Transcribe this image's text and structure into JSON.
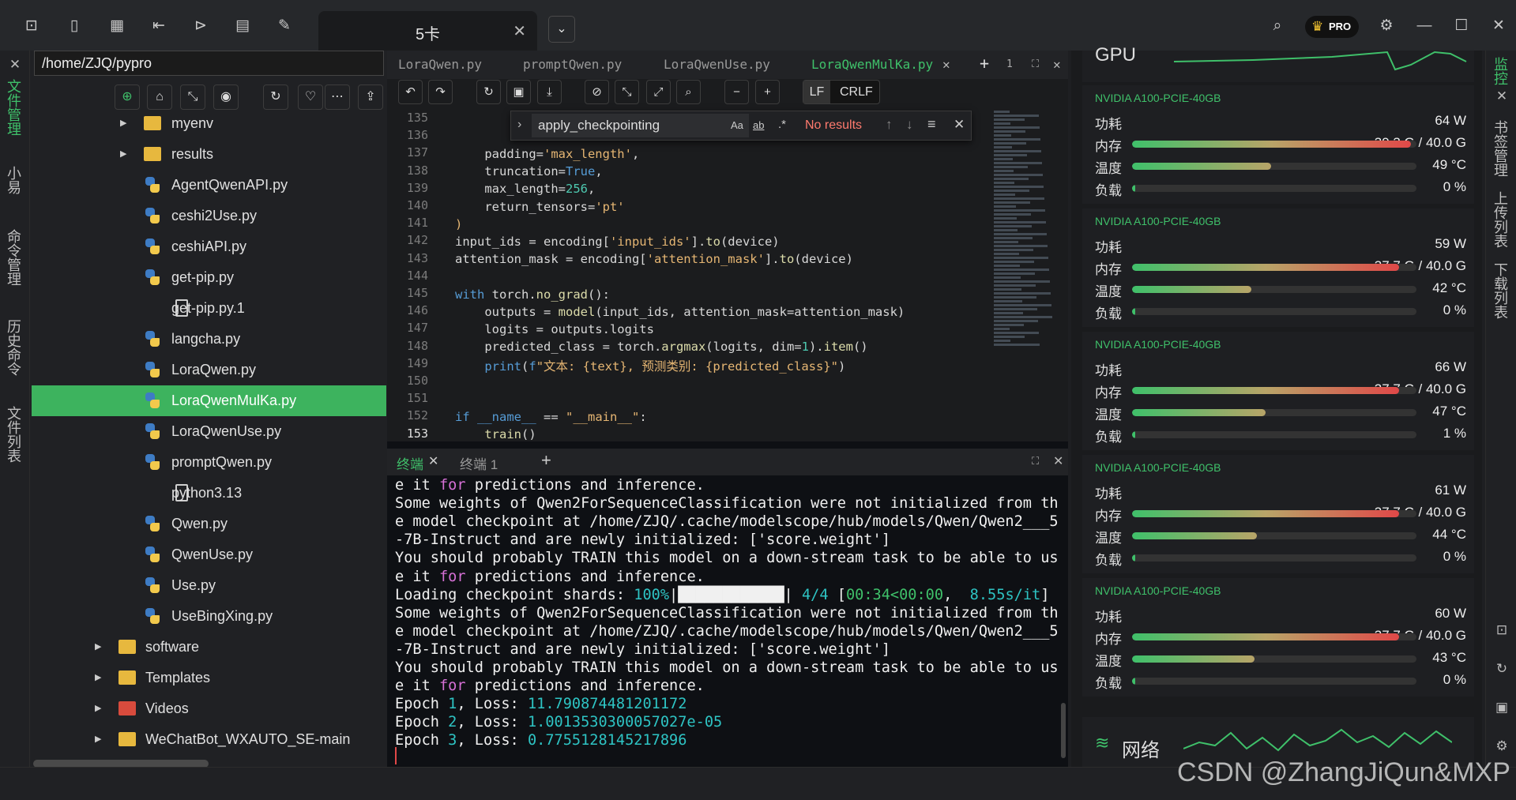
{
  "topbar": {
    "tab_label": "5卡",
    "tab_close": "✕",
    "dropdown": "⌄",
    "pro_badge": "PRO"
  },
  "left_rail": {
    "items": [
      "文件管理",
      "小易",
      "命令管理",
      "历史命令",
      "文件列表"
    ]
  },
  "file_panel": {
    "path": "/home/ZJQ/pypro",
    "items": [
      {
        "name": "myenv",
        "type": "folder",
        "indent": 1
      },
      {
        "name": "results",
        "type": "folder",
        "indent": 1
      },
      {
        "name": "AgentQwenAPI.py",
        "type": "py",
        "indent": 2
      },
      {
        "name": "ceshi2Use.py",
        "type": "py",
        "indent": 2
      },
      {
        "name": "ceshiAPI.py",
        "type": "py",
        "indent": 2
      },
      {
        "name": "get-pip.py",
        "type": "py",
        "indent": 2
      },
      {
        "name": "get-pip.py.1",
        "type": "file",
        "indent": 2
      },
      {
        "name": "langcha.py",
        "type": "py",
        "indent": 2
      },
      {
        "name": "LoraQwen.py",
        "type": "py",
        "indent": 2
      },
      {
        "name": "LoraQwenMulKa.py",
        "type": "py",
        "indent": 2,
        "selected": true
      },
      {
        "name": "LoraQwenUse.py",
        "type": "py",
        "indent": 2
      },
      {
        "name": "promptQwen.py",
        "type": "py",
        "indent": 2
      },
      {
        "name": "python3.13",
        "type": "file",
        "indent": 2
      },
      {
        "name": "Qwen.py",
        "type": "py",
        "indent": 2
      },
      {
        "name": "QwenUse.py",
        "type": "py",
        "indent": 2
      },
      {
        "name": "Use.py",
        "type": "py",
        "indent": 2
      },
      {
        "name": "UseBingXing.py",
        "type": "py",
        "indent": 2
      },
      {
        "name": "software",
        "type": "folder",
        "indent": 0
      },
      {
        "name": "Templates",
        "type": "folder",
        "indent": 0
      },
      {
        "name": "Videos",
        "type": "folder-red",
        "indent": 0
      },
      {
        "name": "WeChatBot_WXAUTO_SE-main",
        "type": "folder",
        "indent": 0
      }
    ]
  },
  "editor": {
    "tabs": [
      "LoraQwen.py",
      "promptQwen.py",
      "LoraQwenUse.py",
      "LoraQwenMulKa.py"
    ],
    "active_tab": "LoraQwenMulKa.py",
    "tab_count": "1",
    "lf": "LF",
    "crlf": "CRLF",
    "find": {
      "query": "apply_checkpointing",
      "no_results": "No results",
      "opt_case": "Aa",
      "opt_word": "ab",
      "opt_regex": ".*"
    },
    "line_numbers": [
      "135",
      "136",
      "137",
      "138",
      "139",
      "140",
      "141",
      "142",
      "143",
      "144",
      "145",
      "146",
      "147",
      "148",
      "149",
      "150",
      "151",
      "152",
      "153"
    ]
  },
  "terminal": {
    "tabs": [
      "终端",
      "终端 1"
    ],
    "lines": [
      "e it for predictions and inference.",
      "Some weights of Qwen2ForSequenceClassification were not initialized from th",
      "e model checkpoint at /home/ZJQ/.cache/modelscope/hub/models/Qwen/Qwen2___5",
      "-7B-Instruct and are newly initialized: ['score.weight']",
      "You should probably TRAIN this model on a down-stream task to be able to us",
      "e it for predictions and inference.",
      "Loading checkpoint shards: 100%|████████████| 4/4 [00:34<00:00,  8.55s/it]",
      "Some weights of Qwen2ForSequenceClassification were not initialized from th",
      "e model checkpoint at /home/ZJQ/.cache/modelscope/hub/models/Qwen/Qwen2___5",
      "-7B-Instruct and are newly initialized: ['score.weight']",
      "You should probably TRAIN this model on a down-stream task to be able to us",
      "e it for predictions and inference.",
      "Epoch 1, Loss: 11.790874481201172",
      "Epoch 2, Loss: 1.0013530300057027e-05",
      "Epoch 3, Loss: 0.7755128145217896"
    ]
  },
  "monitor": {
    "labels": {
      "power": "功耗",
      "mem": "内存",
      "temp": "温度",
      "load": "负载"
    },
    "gpus": [
      {
        "name": "NVIDIA A100-PCIE-40GB",
        "power": "64 W",
        "mem": "39.3 G / 40.0 G",
        "mem_frac": 0.98,
        "temp": "49 °C",
        "temp_frac": 0.49,
        "load": "0 %",
        "load_frac": 0.0
      },
      {
        "name": "NVIDIA A100-PCIE-40GB",
        "power": "59 W",
        "mem": "37.7 G / 40.0 G",
        "mem_frac": 0.94,
        "temp": "42 °C",
        "temp_frac": 0.42,
        "load": "0 %",
        "load_frac": 0.0
      },
      {
        "name": "NVIDIA A100-PCIE-40GB",
        "power": "66 W",
        "mem": "37.7 G / 40.0 G",
        "mem_frac": 0.94,
        "temp": "47 °C",
        "temp_frac": 0.47,
        "load": "1 %",
        "load_frac": 0.01
      },
      {
        "name": "NVIDIA A100-PCIE-40GB",
        "power": "61 W",
        "mem": "37.7 G / 40.0 G",
        "mem_frac": 0.94,
        "temp": "44 °C",
        "temp_frac": 0.44,
        "load": "0 %",
        "load_frac": 0.0
      },
      {
        "name": "NVIDIA A100-PCIE-40GB",
        "power": "60 W",
        "mem": "37.7 G / 40.0 G",
        "mem_frac": 0.94,
        "temp": "43 °C",
        "temp_frac": 0.43,
        "load": "0 %",
        "load_frac": 0.0
      }
    ],
    "network_label": "网络",
    "top_label": "GPU"
  },
  "right_rail": {
    "items": [
      "监控",
      "书签管理",
      "上传列表",
      "下载列表"
    ]
  },
  "watermark": "CSDN @ZhangJiQun&MXP",
  "colors": {
    "accent": "#3fc06a",
    "mem_bar": "#e04848",
    "temp_bar": "#b8a468"
  }
}
